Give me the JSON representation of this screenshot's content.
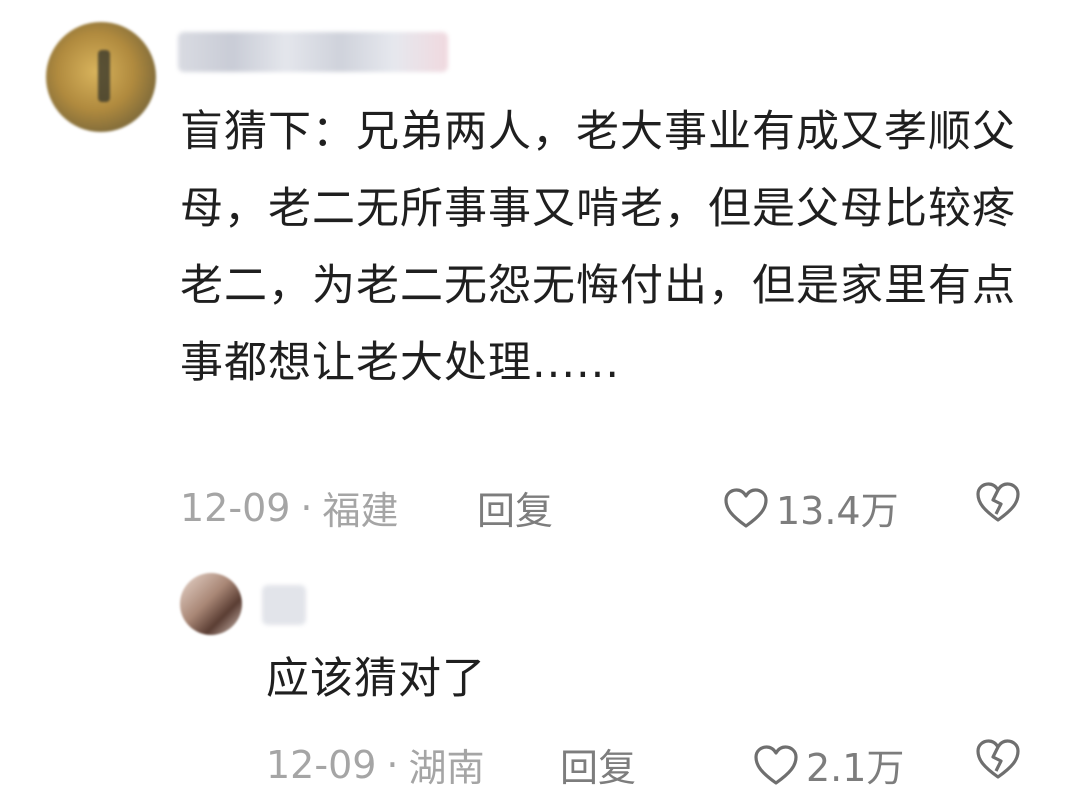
{
  "comment": {
    "text": "盲猜下：兄弟两人，老大事业有成又孝顺父母，老二无所事事又啃老，但是父母比较疼老二，为老二无怨无悔付出，但是家里有点事都想让老大处理......",
    "date": "12-09",
    "separator": "·",
    "location": "福建",
    "reply_label": "回复",
    "likes": "13.4万"
  },
  "reply": {
    "text": "应该猜对了",
    "date": "12-09",
    "separator": "·",
    "location": "湖南",
    "reply_label": "回复",
    "likes": "2.1万"
  },
  "icons": {
    "like": "heart-outline-icon",
    "dislike": "broken-heart-icon"
  },
  "colors": {
    "text": "#1f1f1f",
    "meta": "#a5a5a5",
    "action": "#7d7d7d"
  }
}
